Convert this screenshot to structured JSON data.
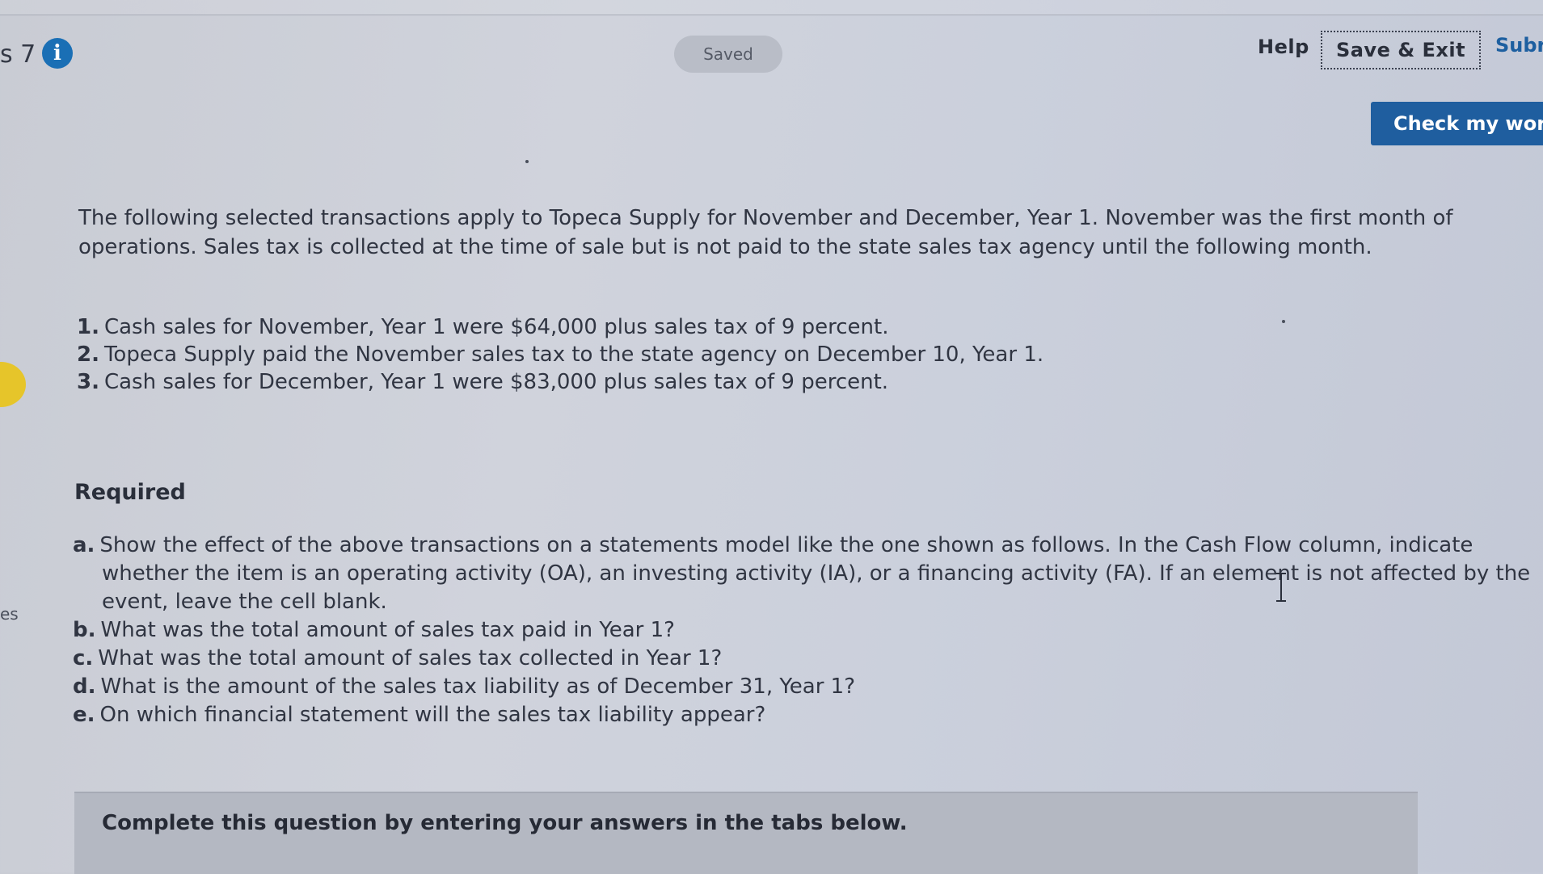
{
  "left_edge": {
    "question_label": "s 7",
    "info_icon": "info-icon",
    "fragment_text": "es"
  },
  "header": {
    "saved_label": "Saved",
    "help_label": "Help",
    "save_exit_label": "Save & Exit",
    "submit_label": "Subr",
    "check_work_label": "Check my worl"
  },
  "problem": {
    "intro": "The following selected transactions apply to Topeca Supply for November and December, Year 1. November was the first month of operations. Sales tax is collected at the time of sale but is not paid to the state sales tax agency until the following month.",
    "transactions": [
      {
        "num": "1.",
        "text": "Cash sales for November, Year 1 were $64,000 plus sales tax of 9 percent."
      },
      {
        "num": "2.",
        "text": "Topeca Supply paid the November sales tax to the state agency on December 10, Year 1."
      },
      {
        "num": "3.",
        "text": "Cash sales for December, Year 1 were $83,000 plus sales tax of 9 percent."
      }
    ],
    "required_heading": "Required",
    "requirements": [
      {
        "letter": "a.",
        "text": "Show the effect of the above transactions on a statements model like the one shown as follows. In the Cash Flow column, indicate whether the item is an operating activity (OA), an investing activity (IA), or a financing activity (FA). If an element is not affected by the event, leave the cell blank."
      },
      {
        "letter": "b.",
        "text": "What was the total amount of sales tax paid in Year 1?"
      },
      {
        "letter": "c.",
        "text": "What was the total amount of sales tax collected in Year 1?"
      },
      {
        "letter": "d.",
        "text": "What is the amount of the sales tax liability as of December 31, Year 1?"
      },
      {
        "letter": "e.",
        "text": "On which financial statement will the sales tax liability appear?"
      }
    ]
  },
  "tabs": {
    "instruction": "Complete this question by entering your answers in the tabs below."
  },
  "colors": {
    "accent_blue": "#1f5e9f",
    "info_blue": "#1a6fb5",
    "marker_yellow": "#e6c52a"
  }
}
